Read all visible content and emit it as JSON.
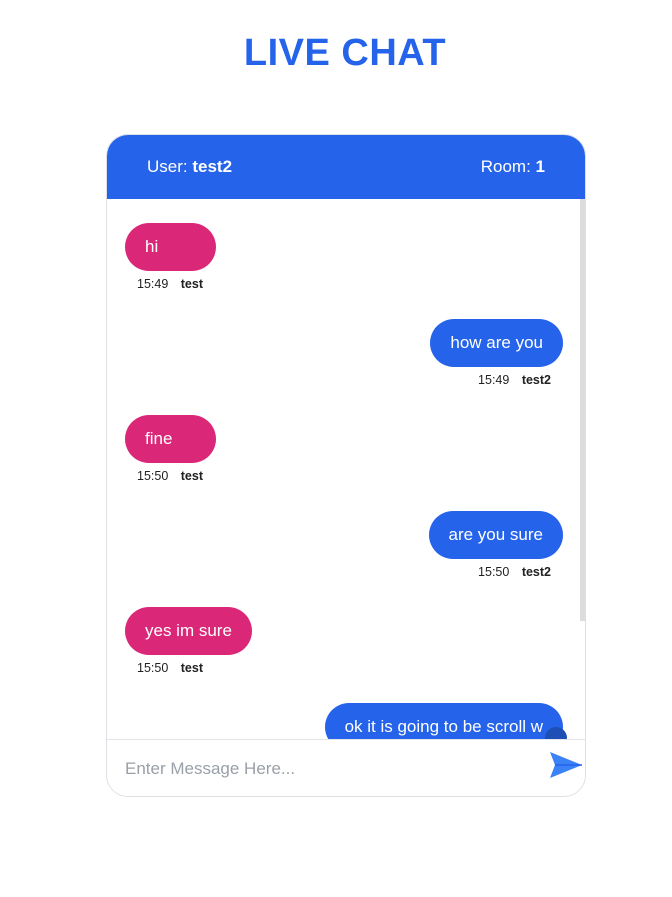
{
  "page": {
    "title": "LIVE CHAT"
  },
  "header": {
    "user_label": "User:",
    "user_name": "test2",
    "room_label": "Room:",
    "room_id": "1"
  },
  "messages": [
    {
      "text": "hi",
      "time": "15:49",
      "author": "test",
      "side": "left"
    },
    {
      "text": "how are you",
      "time": "15:49",
      "author": "test2",
      "side": "right"
    },
    {
      "text": "fine",
      "time": "15:50",
      "author": "test",
      "side": "left"
    },
    {
      "text": "are you sure",
      "time": "15:50",
      "author": "test2",
      "side": "right"
    },
    {
      "text": "yes im sure",
      "time": "15:50",
      "author": "test",
      "side": "left"
    },
    {
      "text": "ok it is going to be scroll w",
      "side": "right"
    }
  ],
  "composer": {
    "placeholder": "Enter Message Here...",
    "send_icon": "send-paper-plane-icon"
  },
  "colors": {
    "accent": "#2563eb",
    "other_bubble": "#db2777",
    "send_icon": "#3b82f6"
  }
}
